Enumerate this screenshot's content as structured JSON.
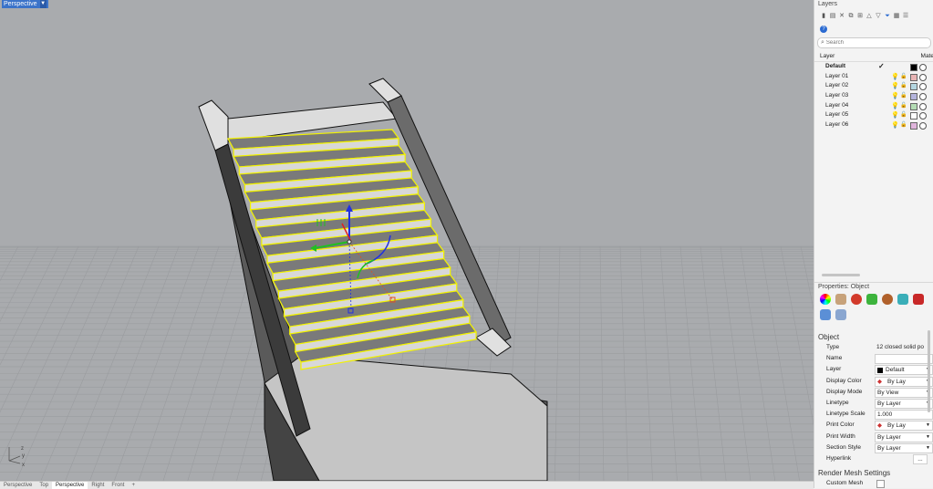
{
  "viewport": {
    "title": "Perspective",
    "dropdown_icon": "caret-down-icon",
    "axis_labels": {
      "x": "x",
      "y": "y",
      "z": "z"
    }
  },
  "bottom_tabs": [
    "Perspective",
    "Top",
    "Perspective",
    "Right",
    "Front",
    "+"
  ],
  "active_bottom_tab": 2,
  "layers_panel": {
    "title": "Layers",
    "search_placeholder": "Search",
    "col_layer": "Layer",
    "col_material": "Mate",
    "layers": [
      {
        "name": "Default",
        "color": "#000000",
        "current": true
      },
      {
        "name": "Layer 01",
        "color": "#e8b4b4",
        "current": false
      },
      {
        "name": "Layer 02",
        "color": "#b4d6e0",
        "current": false
      },
      {
        "name": "Layer 03",
        "color": "#b4b4dc",
        "current": false
      },
      {
        "name": "Layer 04",
        "color": "#b4dcb4",
        "current": false
      },
      {
        "name": "Layer 05",
        "color": "#ffffff",
        "current": false
      },
      {
        "name": "Layer 06",
        "color": "#e0b4dc",
        "current": false
      }
    ],
    "current_mark": "✓"
  },
  "properties_panel": {
    "title": "Properties: Object",
    "section_object": "Object",
    "section_render": "Render Mesh Settings",
    "rows": [
      {
        "key": "Type",
        "value": "12 closed solid po",
        "dropdown": false
      },
      {
        "key": "Name",
        "value": "",
        "dropdown": false
      },
      {
        "key": "Layer",
        "value": "Default",
        "dropdown": true
      },
      {
        "key": "Display Color",
        "value": "By Lay",
        "dropdown": true
      },
      {
        "key": "Display Mode",
        "value": "By View",
        "dropdown": true
      },
      {
        "key": "Linetype",
        "value": "By Layer",
        "dropdown": true
      },
      {
        "key": "Linetype Scale",
        "value": "1.000",
        "dropdown": false
      },
      {
        "key": "Print Color",
        "value": "By Lay",
        "dropdown": true
      },
      {
        "key": "Print Width",
        "value": "By Layer",
        "dropdown": true
      },
      {
        "key": "Section Style",
        "value": "By Layer",
        "dropdown": true
      },
      {
        "key": "Hyperlink",
        "value": "...",
        "dropdown": false
      }
    ],
    "render_row": {
      "key": "Custom Mesh"
    }
  },
  "colors": {
    "viewport_bg": "#a9abae",
    "selection": "#f2f200",
    "tab_active": "#3b73c9"
  }
}
